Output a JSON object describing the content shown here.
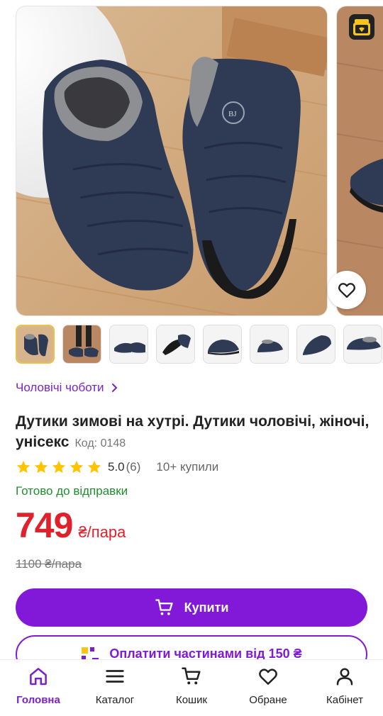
{
  "colors": {
    "accent": "#8219d8",
    "price": "#e0212b",
    "in_stock": "#1f8f2e",
    "star": "#ffc400"
  },
  "gallery": {
    "main_photo_icon": "product-photo",
    "promo_badge_icon": "gift-box-icon",
    "favorite_icon": "heart-icon",
    "thumbnail_count": 8
  },
  "breadcrumb": {
    "label": "Чоловічі чоботи",
    "icon": "chevron-right-icon"
  },
  "product": {
    "title": "Дутики зимові на хутрі. Дутики чоловічі, жіночі, унісекс",
    "code": "Код: 0148",
    "rating_value": "5.0",
    "rating_count": "(6)",
    "rating_stars": 5,
    "bought": "10+ купили",
    "availability": "Готово до відправки",
    "price": "749",
    "price_unit": "₴/пара",
    "old_price": "1100 ₴/пара"
  },
  "actions": {
    "buy_label": "Купити",
    "buy_icon": "cart-icon",
    "parts_label": "Оплатити частинами від 150 ₴",
    "parts_icon": "installment-icon"
  },
  "tabbar": {
    "items": [
      {
        "label": "Головна",
        "icon": "home-icon",
        "active": true
      },
      {
        "label": "Каталог",
        "icon": "menu-icon",
        "active": false
      },
      {
        "label": "Кошик",
        "icon": "cart-icon",
        "active": false
      },
      {
        "label": "Обране",
        "icon": "heart-icon",
        "active": false
      },
      {
        "label": "Кабінет",
        "icon": "user-icon",
        "active": false
      }
    ]
  }
}
